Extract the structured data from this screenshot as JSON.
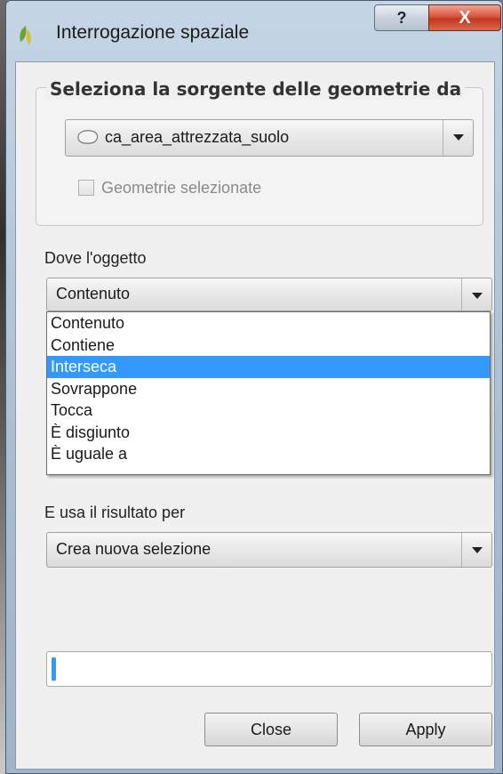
{
  "window": {
    "title": "Interrogazione spaziale",
    "help_label": "?",
    "close_label": "X"
  },
  "source_group": {
    "title": "Seleziona la sorgente delle geometrie da",
    "layer_value": "ca_area_attrezzata_suolo",
    "selected_only_label": "Geometrie selezionate",
    "selected_only_checked": false
  },
  "predicate": {
    "label": "Dove l'oggetto",
    "value": "Contenuto",
    "options": [
      "Contenuto",
      "Contiene",
      "Interseca",
      "Sovrappone",
      "Tocca",
      "È disgiunto",
      "È uguale a"
    ],
    "highlighted_index": 2
  },
  "result": {
    "label": "E usa il risultato per",
    "value": "Crea nuova selezione"
  },
  "progress": {
    "value": 0.01
  },
  "buttons": {
    "close": "Close",
    "apply": "Apply"
  },
  "colors": {
    "highlight": "#3399ff",
    "close_button": "#c4361e",
    "logo_green": "#6aa53a"
  },
  "icons": {
    "app": "qgis-logo-icon",
    "layer": "polygon-layer-icon",
    "dropdown": "chevron-down-icon"
  }
}
